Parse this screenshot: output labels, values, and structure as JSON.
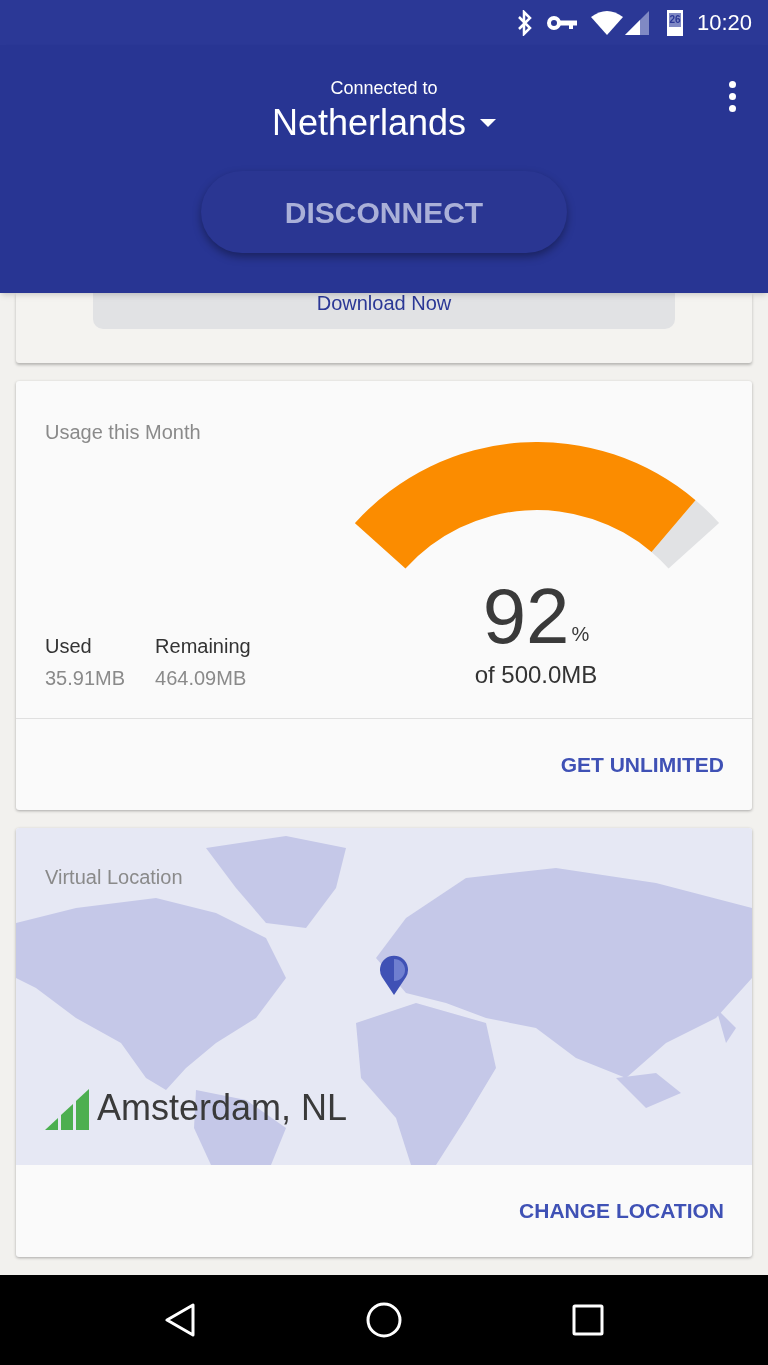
{
  "status_bar": {
    "time": "10:20",
    "battery": "26"
  },
  "header": {
    "subtitle": "Connected to",
    "country": "Netherlands",
    "button": "DISCONNECT"
  },
  "promo_card": {
    "button": "Download Now"
  },
  "usage_card": {
    "title": "Usage this Month",
    "stats": [
      {
        "label": "Used",
        "value": "35.91MB"
      },
      {
        "label": "Remaining",
        "value": "464.09MB"
      }
    ],
    "gauge": {
      "level": 0.92,
      "percent": "92",
      "unit": "%",
      "total": "of 500.0MB"
    },
    "action": "GET UNLIMITED"
  },
  "location_card": {
    "title": "Virtual Location",
    "city": "Amsterdam, NL",
    "action": "CHANGE LOCATION"
  }
}
